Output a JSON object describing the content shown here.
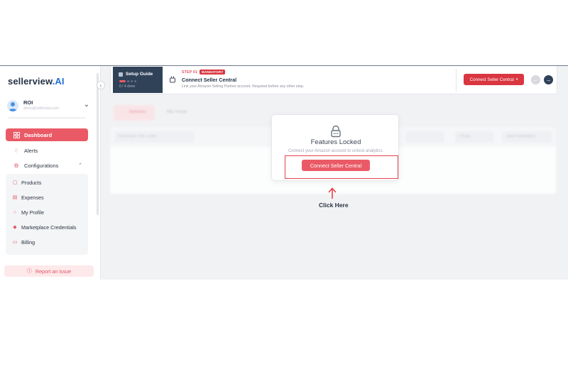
{
  "sidebar": {
    "logo_main": "sellerview",
    "logo_ai": ".AI",
    "user": {
      "name": "ROI",
      "email": "demo@sellerview.com"
    },
    "nav": [
      {
        "label": "Dashboard",
        "icon": "grid-icon",
        "active": true
      },
      {
        "label": "Alerts",
        "icon": "bell-icon"
      },
      {
        "label": "Configurations",
        "icon": "gear-icon"
      }
    ],
    "submenu": [
      {
        "label": "Products",
        "icon": "box-icon"
      },
      {
        "label": "Expenses",
        "icon": "wallet-icon"
      },
      {
        "label": "My Profile",
        "icon": "user-icon"
      },
      {
        "label": "Marketplace Credentials",
        "icon": "key-icon"
      },
      {
        "label": "Billing",
        "icon": "card-icon"
      }
    ],
    "report_label": "Report an issue"
  },
  "setup": {
    "guide_title": "Setup Guide",
    "guide_progress": "0 / 4 done",
    "step_label": "STEP 01",
    "badge": "MANDATORY",
    "title": "Connect Seller Central",
    "description": "Link your Amazon Selling Partner account. Required before any other step.",
    "connect_label": "Connect Seller Central"
  },
  "main": {
    "tab_a": "Overview",
    "tab_b": "P&L Trends",
    "filter_date": "Select Date: Feb 1–2026",
    "filter_group": "All Day",
    "filter_market": "Select Marketplace"
  },
  "modal": {
    "title": "Features Locked",
    "subtitle": "Connect your Amazon account to unlock analytics.",
    "button": "Connect Seller Central"
  },
  "annotation": {
    "label": "Click Here"
  },
  "colors": {
    "accent": "#ea5a66",
    "navy": "#2f4258",
    "danger": "#d9363f"
  }
}
